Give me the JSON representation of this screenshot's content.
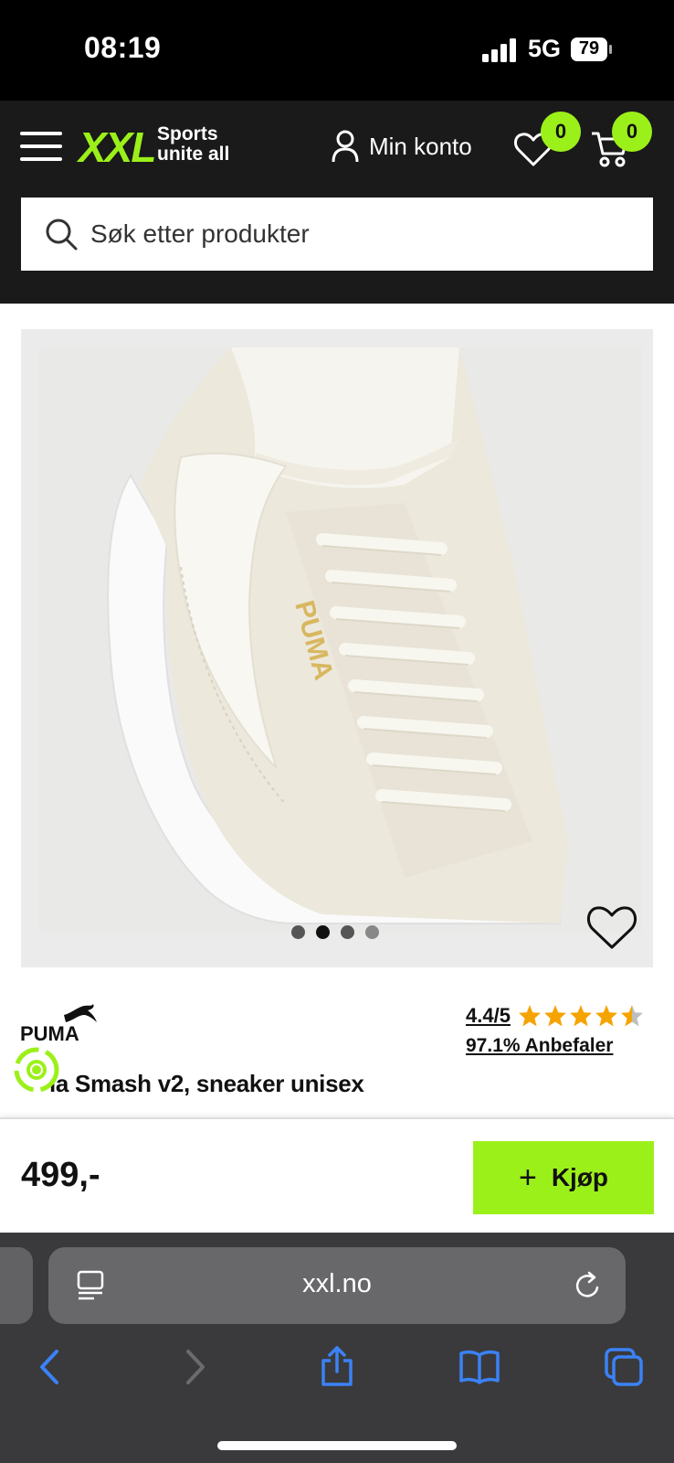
{
  "status_bar": {
    "time": "08:19",
    "network": "5G",
    "battery": "79"
  },
  "header": {
    "logo_text": "XXL",
    "tagline_line1": "Sports",
    "tagline_line2": "unite all",
    "account_label": "Min konto",
    "wishlist_count": "0",
    "cart_count": "0",
    "accent_color": "#9cf01a"
  },
  "search": {
    "placeholder": "Søk etter produkter"
  },
  "product": {
    "brand": "PUMA",
    "name": "Puma Smash v2, sneaker unisex",
    "visible_name": "ıa Smash v2, sneaker unisex",
    "rating": "4.4/5",
    "rating_value": 4.4,
    "rating_max": 5,
    "recommend": "97.1% Anbefaler",
    "carousel": {
      "count": 4,
      "active": 1
    }
  },
  "buy_bar": {
    "price": "499,-",
    "buy_label": "Kjøp"
  },
  "browser": {
    "url": "xxl.no"
  }
}
